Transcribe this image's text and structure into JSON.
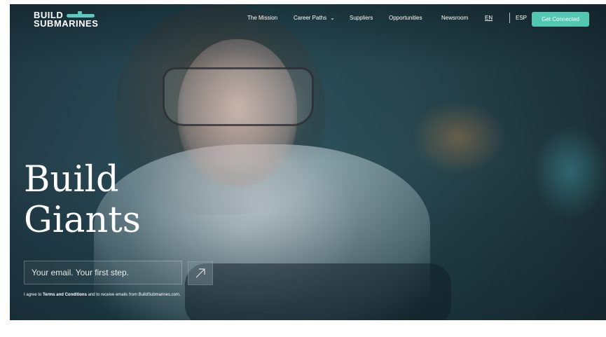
{
  "logo": {
    "line1": "BUILD",
    "line2": "SUBMARINES"
  },
  "nav": {
    "mission": "The Mission",
    "careers": "Career Paths",
    "suppliers": "Suppliers",
    "opportunities": "Opportunities",
    "newsroom": "Newsroom",
    "lang_en": "EN",
    "lang_es": "ESP",
    "cta": "Get Connected"
  },
  "hero": {
    "title_line1": "Build",
    "title_line2": "Giants",
    "email_placeholder": "Your email. Your first step.",
    "terms_prefix": "I agree to ",
    "terms_link": "Terms and Conditions",
    "terms_suffix": " and to receive emails from BuildSubmarines.com."
  },
  "icons": {
    "submit": "arrow-up-right-icon",
    "dropdown": "chevron-down-icon",
    "logo_mark": "submarine-icon"
  },
  "colors": {
    "accent": "#52c7b4",
    "logo_accent": "#5fc9bd"
  }
}
